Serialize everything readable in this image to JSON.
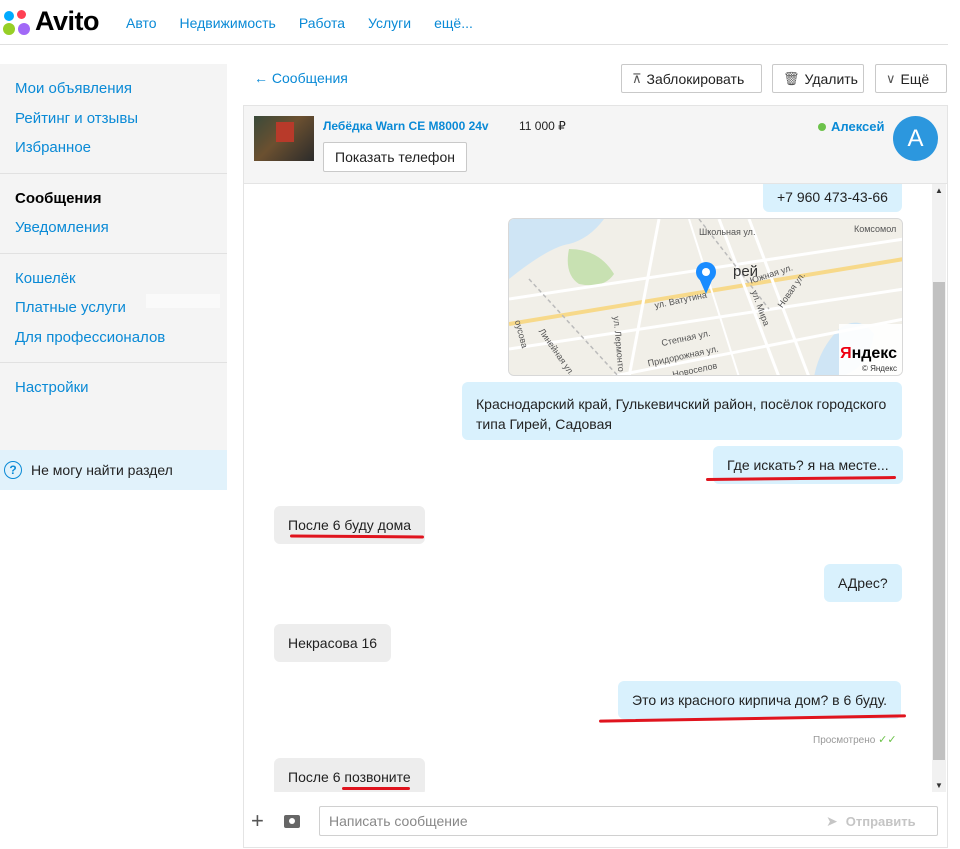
{
  "header": {
    "logo": "Avito",
    "nav": [
      "Авто",
      "Недвижимость",
      "Работа",
      "Услуги",
      "ещё..."
    ]
  },
  "sidebar": {
    "group1": [
      "Мои объявления",
      "Рейтинг и отзывы",
      "Избранное"
    ],
    "group2": [
      "Сообщения",
      "Уведомления"
    ],
    "group3": [
      "Кошелёк",
      "Платные услуги",
      "Для профессионалов"
    ],
    "group4": [
      "Настройки"
    ],
    "help": "Не могу найти раздел"
  },
  "toolbar": {
    "back": "← Сообщения",
    "block": "Заблокировать",
    "delete": "Удалить",
    "more": "Ещё"
  },
  "item": {
    "title": "Лебёдка Warn CE M8000 24v",
    "price": "11 000 ₽",
    "show_phone": "Показать телефон"
  },
  "user": {
    "name": "Алексей",
    "initial": "А",
    "status_color": "#6cc24a"
  },
  "messages": [
    {
      "dir": "out",
      "text": "+7 960 473-43-66"
    },
    {
      "dir": "out",
      "text": "Краснодарский край, Гулькевичский район, посёлок городского типа Гирей, Садовая"
    },
    {
      "dir": "out",
      "text": "Где искать? я на месте..."
    },
    {
      "dir": "in",
      "text": "После 6 буду дома"
    },
    {
      "dir": "out",
      "text": "АДрес?"
    },
    {
      "dir": "in",
      "text": "Некрасова 16"
    },
    {
      "dir": "out",
      "text": "Это из красного кирпича дом?  в 6 буду."
    },
    {
      "dir": "in",
      "text": "После 6 позвоните"
    }
  ],
  "map": {
    "labels": [
      "Комсомол",
      "ул. Ватутина",
      "Южная ул.",
      "Новая ул.",
      "ул. Мира",
      "Степная ул.",
      "Придорожная ул.",
      "Новоселов",
      "ул. Лермонто",
      "Линейная ул.",
      "оусова",
      "рей",
      "Школьная ул."
    ],
    "brand": "Яндекс",
    "brand_small": "© Яндекс"
  },
  "seen": "Просмотрено",
  "composer": {
    "placeholder": "Написать сообщение",
    "send": "Отправить"
  },
  "colors": {
    "accent": "#0a8ad6",
    "out_bubble": "#d9f1fd",
    "in_bubble": "#ededed",
    "underline": "#e0141e"
  }
}
